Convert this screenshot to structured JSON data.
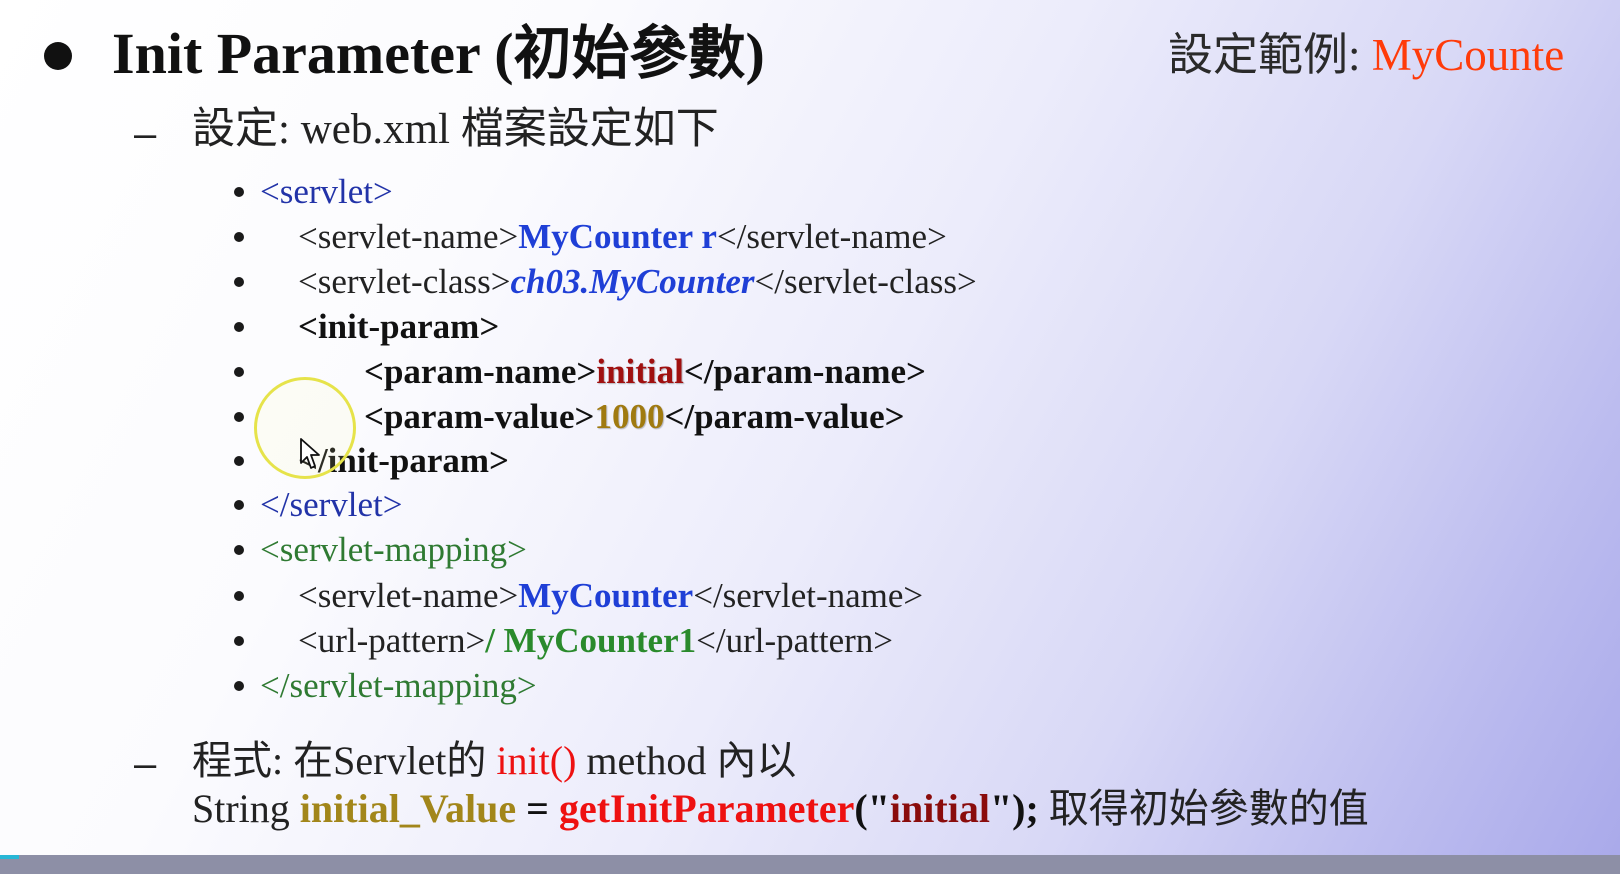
{
  "slide": {
    "title": "Init Parameter (初始參數)",
    "example_label": "設定範例:",
    "example_name": "MyCounte",
    "setting_dash": "–",
    "setting_text": "設定: web.xml 檔案設定如下",
    "xml_lines": {
      "l1": "<servlet>",
      "l2_open": "<servlet-name>",
      "l2_value": "MyCounter r",
      "l2_close": "</servlet-name>",
      "l3_open": "<servlet-class>",
      "l3_value": "ch03.MyCounter",
      "l3_close": "</servlet-class>",
      "l4": "<init-param>",
      "l5_open": "<param-name>",
      "l5_value": "initial",
      "l5_close": "</param-name>",
      "l6_open": "<param-value>",
      "l6_value": "1000",
      "l6_close": "</param-value>",
      "l7": "</init-param>",
      "l8": "</servlet>",
      "l9": "<servlet-mapping>",
      "l10_open": "<servlet-name>",
      "l10_value": "MyCounter",
      "l10_close": "</servlet-name>",
      "l11_open": "<url-pattern>",
      "l11_value": "/ MyCounter1",
      "l11_close": "</url-pattern>",
      "l12": "</servlet-mapping>"
    },
    "program_dash": "–",
    "program_prefix": "程式: 在Servlet的",
    "program_init": "init()",
    "program_suffix": "method 內以",
    "code": {
      "type": "String",
      "var": "initial_Value",
      "eq": "=",
      "method": "getInitParameter",
      "paren_open": "(\"",
      "arg": "initial",
      "paren_close": "\");",
      "note": "取得初始參數的值"
    }
  },
  "video_progress_fraction": 0.012,
  "colors": {
    "accent_orange": "#ff3b0a",
    "tag_blue": "#2233a8",
    "tag_green": "#2f7a32",
    "progress": "#27b7d6"
  }
}
